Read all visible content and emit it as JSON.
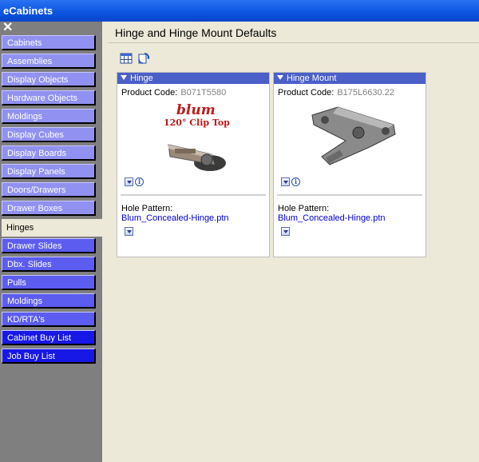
{
  "window": {
    "title": "eCabinets"
  },
  "sidebar": {
    "close_glyph": "✕",
    "items": [
      {
        "label": "Cabinets"
      },
      {
        "label": "Assemblies"
      },
      {
        "label": "Display Objects"
      },
      {
        "label": "Hardware Objects"
      },
      {
        "label": "Moldings"
      },
      {
        "label": "Display Cubes"
      },
      {
        "label": "Display Boards"
      },
      {
        "label": "Display Panels"
      },
      {
        "label": "Doors/Drawers"
      },
      {
        "label": "Drawer Boxes"
      },
      {
        "label": "Hinges"
      },
      {
        "label": "Drawer Slides"
      },
      {
        "label": "Dbx. Slides"
      },
      {
        "label": "Pulls"
      },
      {
        "label": "Moldings"
      },
      {
        "label": "KD/RTA's"
      },
      {
        "label": "Cabinet Buy List"
      },
      {
        "label": "Job Buy List"
      }
    ],
    "active_item": "Hinges"
  },
  "main": {
    "title": "Hinge and Hinge Mount Defaults",
    "toolbar": {
      "icons": [
        "grid-icon",
        "refresh-icon"
      ]
    },
    "panels": [
      {
        "header": "Hinge",
        "product_code_label": "Product Code:",
        "product_code": "B071T5580",
        "image_brand": "blum",
        "image_caption": "120° Clip Top",
        "hole_pattern_label": "Hole Pattern:",
        "hole_pattern": "Blum_Concealed-Hinge.ptn"
      },
      {
        "header": "Hinge Mount",
        "product_code_label": "Product Code:",
        "product_code": "B175L6630.22",
        "hole_pattern_label": "Hole Pattern:",
        "hole_pattern": "Blum_Concealed-Hinge.ptn"
      }
    ]
  },
  "colors": {
    "titlebar": "#0a54e0",
    "nav_light": "#9191f2",
    "nav_mid": "#5c5cf0",
    "nav_dark": "#1717e6",
    "panel_header": "#4a5fc8",
    "link": "#0000d0"
  }
}
